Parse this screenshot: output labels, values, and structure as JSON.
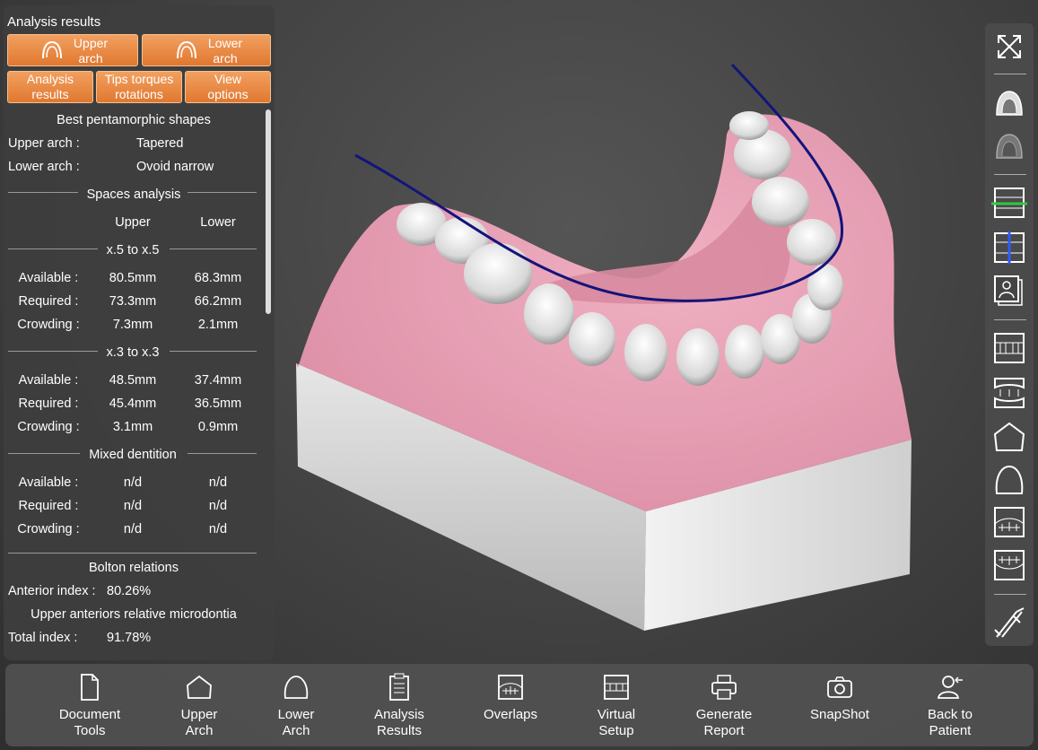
{
  "panel": {
    "title": "Analysis results",
    "upper_arch_btn": "Upper\narch",
    "lower_arch_btn": "Lower\narch",
    "tabs": [
      "Analysis\nresults",
      "Tips torques\nrotations",
      "View\noptions"
    ]
  },
  "pentamorphic": {
    "heading": "Best pentamorphic shapes",
    "upper_label": "Upper arch :",
    "upper_value": "Tapered",
    "lower_label": "Lower arch :",
    "lower_value": "Ovoid narrow"
  },
  "spaces": {
    "heading": "Spaces analysis",
    "col_upper": "Upper",
    "col_lower": "Lower",
    "sections": [
      {
        "title": "x.5 to x.5",
        "rows": [
          {
            "label": "Available :",
            "upper": "80.5mm",
            "lower": "68.3mm"
          },
          {
            "label": "Required :",
            "upper": "73.3mm",
            "lower": "66.2mm"
          },
          {
            "label": "Crowding :",
            "upper": "7.3mm",
            "lower": "2.1mm"
          }
        ]
      },
      {
        "title": "x.3 to x.3",
        "rows": [
          {
            "label": "Available :",
            "upper": "48.5mm",
            "lower": "37.4mm"
          },
          {
            "label": "Required :",
            "upper": "45.4mm",
            "lower": "36.5mm"
          },
          {
            "label": "Crowding :",
            "upper": "3.1mm",
            "lower": "0.9mm"
          }
        ]
      },
      {
        "title": "Mixed dentition",
        "rows": [
          {
            "label": "Available :",
            "upper": "n/d",
            "lower": "n/d"
          },
          {
            "label": "Required :",
            "upper": "n/d",
            "lower": "n/d"
          },
          {
            "label": "Crowding :",
            "upper": "n/d",
            "lower": "n/d"
          }
        ]
      }
    ]
  },
  "bolton": {
    "heading": "Bolton relations",
    "anterior_label": "Anterior index :",
    "anterior_value": "80.26%",
    "anterior_note": "Upper anteriors relative microdontia",
    "total_label": "Total index :",
    "total_value": "91.78%"
  },
  "right_toolbar": {
    "icons": [
      "fullscreen-icon",
      "upper-arch-icon",
      "lower-arch-icon",
      "occlusal-plane-icon",
      "midline-icon",
      "photos-icon",
      "occlusion-front-icon",
      "occlusion-open-icon",
      "upper-arch-shape-icon",
      "lower-arch-shape-icon",
      "overlap-upper-icon",
      "overlap-lower-icon",
      "caliper-icon"
    ]
  },
  "bottom_toolbar": {
    "items": [
      {
        "label": "Document\nTools",
        "icon": "document-icon"
      },
      {
        "label": "Upper\nArch",
        "icon": "upper-arch-outline-icon"
      },
      {
        "label": "Lower\nArch",
        "icon": "lower-arch-outline-icon"
      },
      {
        "label": "Analysis\nResults",
        "icon": "clipboard-icon"
      },
      {
        "label": "Overlaps",
        "icon": "overlaps-icon"
      },
      {
        "label": "Virtual\nSetup",
        "icon": "virtual-setup-icon"
      },
      {
        "label": "Generate\nReport",
        "icon": "printer-icon"
      },
      {
        "label": "SnapShot",
        "icon": "camera-icon"
      },
      {
        "label": "Back to\nPatient",
        "icon": "patient-icon"
      }
    ]
  },
  "colors": {
    "accent_orange": "#e88a3a",
    "gum_pink": "#e59ab0",
    "arch_line": "#1a1a80",
    "base_grey": "#d8d8d8"
  }
}
